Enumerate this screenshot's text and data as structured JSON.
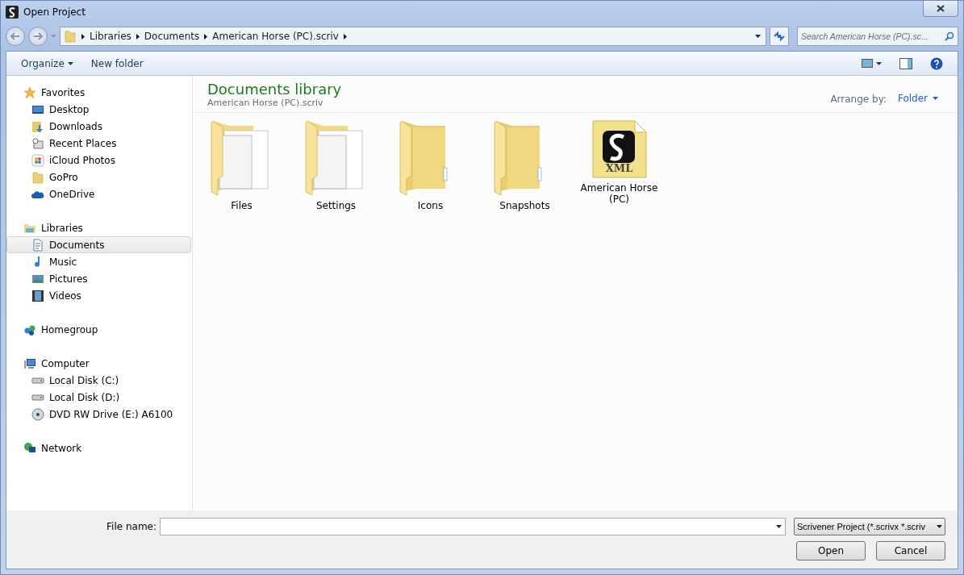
{
  "window": {
    "title": "Open Project"
  },
  "address": {
    "crumbs": [
      "Libraries",
      "Documents",
      "American Horse (PC).scriv"
    ]
  },
  "search": {
    "placeholder": "Search American Horse (PC).sc..."
  },
  "toolbar": {
    "organize": "Organize",
    "new_folder": "New folder"
  },
  "sidebar": [
    {
      "label": "Favorites",
      "kind": "star",
      "children": [
        {
          "label": "Desktop",
          "kind": "desktop",
          "selected": false
        },
        {
          "label": "Downloads",
          "kind": "downloads",
          "selected": false
        },
        {
          "label": "Recent Places",
          "kind": "recent",
          "selected": false
        },
        {
          "label": "iCloud Photos",
          "kind": "photos",
          "selected": false
        },
        {
          "label": "GoPro",
          "kind": "folder",
          "selected": false
        },
        {
          "label": "OneDrive",
          "kind": "cloud",
          "selected": false
        }
      ]
    },
    {
      "label": "Libraries",
      "kind": "library",
      "children": [
        {
          "label": "Documents",
          "kind": "document",
          "selected": true
        },
        {
          "label": "Music",
          "kind": "music",
          "selected": false
        },
        {
          "label": "Pictures",
          "kind": "pictures",
          "selected": false
        },
        {
          "label": "Videos",
          "kind": "videos",
          "selected": false
        }
      ]
    },
    {
      "label": "Homegroup",
      "kind": "homegroup"
    },
    {
      "label": "Computer",
      "kind": "computer",
      "children": [
        {
          "label": "Local Disk (C:)",
          "kind": "disk",
          "selected": false
        },
        {
          "label": "Local Disk (D:)",
          "kind": "disk",
          "selected": false
        },
        {
          "label": "DVD RW Drive (E:) A6100",
          "kind": "dvd",
          "selected": false
        }
      ]
    },
    {
      "label": "Network",
      "kind": "network"
    }
  ],
  "content": {
    "title": "Documents library",
    "subtitle": "American Horse (PC).scriv",
    "arrange_label": "Arrange by:",
    "arrange_value": "Folder"
  },
  "files": [
    {
      "name": "Files",
      "kind": "folder-docs"
    },
    {
      "name": "Settings",
      "kind": "folder-docs"
    },
    {
      "name": "Icons",
      "kind": "folder"
    },
    {
      "name": "Snapshots",
      "kind": "folder"
    },
    {
      "name": "American Horse (PC)",
      "kind": "project",
      "badge": "XML"
    }
  ],
  "footer": {
    "file_name_label": "File name:",
    "filter": "Scrivener Project (*.scrivx *.scriv",
    "open": "Open",
    "cancel": "Cancel"
  }
}
